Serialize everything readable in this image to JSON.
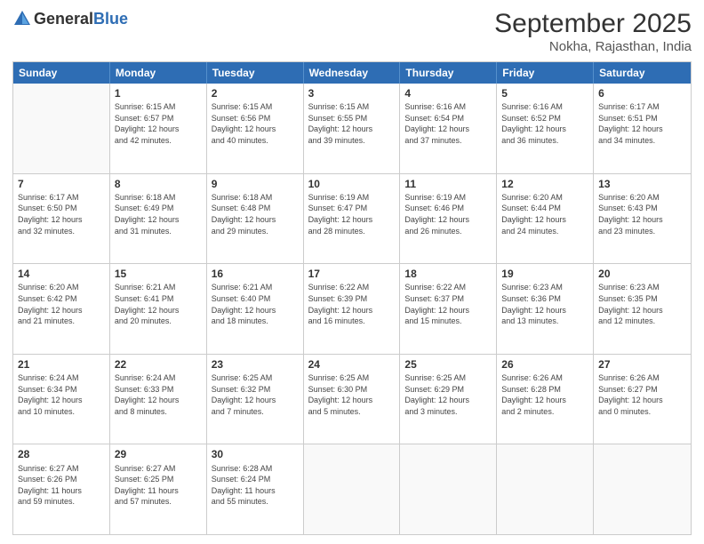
{
  "header": {
    "logo_general": "General",
    "logo_blue": "Blue",
    "month_title": "September 2025",
    "subtitle": "Nokha, Rajasthan, India"
  },
  "days_of_week": [
    "Sunday",
    "Monday",
    "Tuesday",
    "Wednesday",
    "Thursday",
    "Friday",
    "Saturday"
  ],
  "rows": [
    [
      {
        "day": "",
        "info": ""
      },
      {
        "day": "1",
        "info": "Sunrise: 6:15 AM\nSunset: 6:57 PM\nDaylight: 12 hours\nand 42 minutes."
      },
      {
        "day": "2",
        "info": "Sunrise: 6:15 AM\nSunset: 6:56 PM\nDaylight: 12 hours\nand 40 minutes."
      },
      {
        "day": "3",
        "info": "Sunrise: 6:15 AM\nSunset: 6:55 PM\nDaylight: 12 hours\nand 39 minutes."
      },
      {
        "day": "4",
        "info": "Sunrise: 6:16 AM\nSunset: 6:54 PM\nDaylight: 12 hours\nand 37 minutes."
      },
      {
        "day": "5",
        "info": "Sunrise: 6:16 AM\nSunset: 6:52 PM\nDaylight: 12 hours\nand 36 minutes."
      },
      {
        "day": "6",
        "info": "Sunrise: 6:17 AM\nSunset: 6:51 PM\nDaylight: 12 hours\nand 34 minutes."
      }
    ],
    [
      {
        "day": "7",
        "info": "Sunrise: 6:17 AM\nSunset: 6:50 PM\nDaylight: 12 hours\nand 32 minutes."
      },
      {
        "day": "8",
        "info": "Sunrise: 6:18 AM\nSunset: 6:49 PM\nDaylight: 12 hours\nand 31 minutes."
      },
      {
        "day": "9",
        "info": "Sunrise: 6:18 AM\nSunset: 6:48 PM\nDaylight: 12 hours\nand 29 minutes."
      },
      {
        "day": "10",
        "info": "Sunrise: 6:19 AM\nSunset: 6:47 PM\nDaylight: 12 hours\nand 28 minutes."
      },
      {
        "day": "11",
        "info": "Sunrise: 6:19 AM\nSunset: 6:46 PM\nDaylight: 12 hours\nand 26 minutes."
      },
      {
        "day": "12",
        "info": "Sunrise: 6:20 AM\nSunset: 6:44 PM\nDaylight: 12 hours\nand 24 minutes."
      },
      {
        "day": "13",
        "info": "Sunrise: 6:20 AM\nSunset: 6:43 PM\nDaylight: 12 hours\nand 23 minutes."
      }
    ],
    [
      {
        "day": "14",
        "info": "Sunrise: 6:20 AM\nSunset: 6:42 PM\nDaylight: 12 hours\nand 21 minutes."
      },
      {
        "day": "15",
        "info": "Sunrise: 6:21 AM\nSunset: 6:41 PM\nDaylight: 12 hours\nand 20 minutes."
      },
      {
        "day": "16",
        "info": "Sunrise: 6:21 AM\nSunset: 6:40 PM\nDaylight: 12 hours\nand 18 minutes."
      },
      {
        "day": "17",
        "info": "Sunrise: 6:22 AM\nSunset: 6:39 PM\nDaylight: 12 hours\nand 16 minutes."
      },
      {
        "day": "18",
        "info": "Sunrise: 6:22 AM\nSunset: 6:37 PM\nDaylight: 12 hours\nand 15 minutes."
      },
      {
        "day": "19",
        "info": "Sunrise: 6:23 AM\nSunset: 6:36 PM\nDaylight: 12 hours\nand 13 minutes."
      },
      {
        "day": "20",
        "info": "Sunrise: 6:23 AM\nSunset: 6:35 PM\nDaylight: 12 hours\nand 12 minutes."
      }
    ],
    [
      {
        "day": "21",
        "info": "Sunrise: 6:24 AM\nSunset: 6:34 PM\nDaylight: 12 hours\nand 10 minutes."
      },
      {
        "day": "22",
        "info": "Sunrise: 6:24 AM\nSunset: 6:33 PM\nDaylight: 12 hours\nand 8 minutes."
      },
      {
        "day": "23",
        "info": "Sunrise: 6:25 AM\nSunset: 6:32 PM\nDaylight: 12 hours\nand 7 minutes."
      },
      {
        "day": "24",
        "info": "Sunrise: 6:25 AM\nSunset: 6:30 PM\nDaylight: 12 hours\nand 5 minutes."
      },
      {
        "day": "25",
        "info": "Sunrise: 6:25 AM\nSunset: 6:29 PM\nDaylight: 12 hours\nand 3 minutes."
      },
      {
        "day": "26",
        "info": "Sunrise: 6:26 AM\nSunset: 6:28 PM\nDaylight: 12 hours\nand 2 minutes."
      },
      {
        "day": "27",
        "info": "Sunrise: 6:26 AM\nSunset: 6:27 PM\nDaylight: 12 hours\nand 0 minutes."
      }
    ],
    [
      {
        "day": "28",
        "info": "Sunrise: 6:27 AM\nSunset: 6:26 PM\nDaylight: 11 hours\nand 59 minutes."
      },
      {
        "day": "29",
        "info": "Sunrise: 6:27 AM\nSunset: 6:25 PM\nDaylight: 11 hours\nand 57 minutes."
      },
      {
        "day": "30",
        "info": "Sunrise: 6:28 AM\nSunset: 6:24 PM\nDaylight: 11 hours\nand 55 minutes."
      },
      {
        "day": "",
        "info": ""
      },
      {
        "day": "",
        "info": ""
      },
      {
        "day": "",
        "info": ""
      },
      {
        "day": "",
        "info": ""
      }
    ]
  ]
}
